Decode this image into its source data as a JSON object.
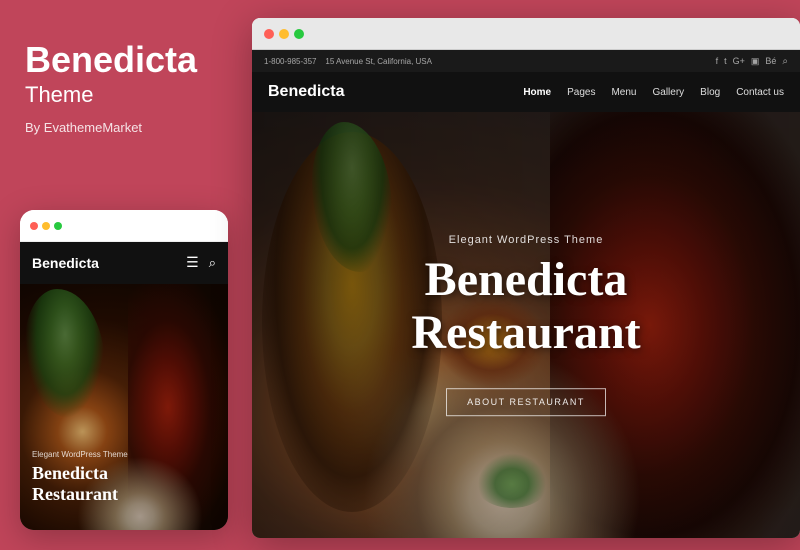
{
  "leftPanel": {
    "themeTitle": "Benedicta",
    "themeSubtitle": "Theme",
    "authorLabel": "By EvathemeMarket"
  },
  "mobileMockup": {
    "dots": [
      {
        "color": "#ff5f56"
      },
      {
        "color": "#ffbd2e"
      },
      {
        "color": "#27c93f"
      }
    ],
    "navLogo": "Benedicta",
    "heroSmallText": "Elegant WordPress Theme",
    "heroTitle": "Benedicta\nRestaurant"
  },
  "browserMockup": {
    "dots": [
      {
        "color": "#ff5f56"
      },
      {
        "color": "#ffbd2e"
      },
      {
        "color": "#27c93f"
      }
    ],
    "topBarLeft": "1-800-985-357",
    "topBarAddress": "15 Avenue St, California, USA",
    "navLogo": "Benedicta",
    "navLinks": [
      {
        "label": "Home",
        "active": true
      },
      {
        "label": "Pages",
        "active": false
      },
      {
        "label": "Menu",
        "active": false
      },
      {
        "label": "Gallery",
        "active": false
      },
      {
        "label": "Blog",
        "active": false
      },
      {
        "label": "Contact us",
        "active": false
      }
    ],
    "heroTagline": "Elegant WordPress Theme",
    "heroTitle1": "Benedicta",
    "heroTitle2": "Restaurant",
    "heroCta": "ABOUT RESTAURANT"
  },
  "colors": {
    "background": "#c0455a",
    "mobileDot1": "#ff5f56",
    "mobileDot2": "#ffbd2e",
    "mobileDot3": "#27c93f"
  }
}
